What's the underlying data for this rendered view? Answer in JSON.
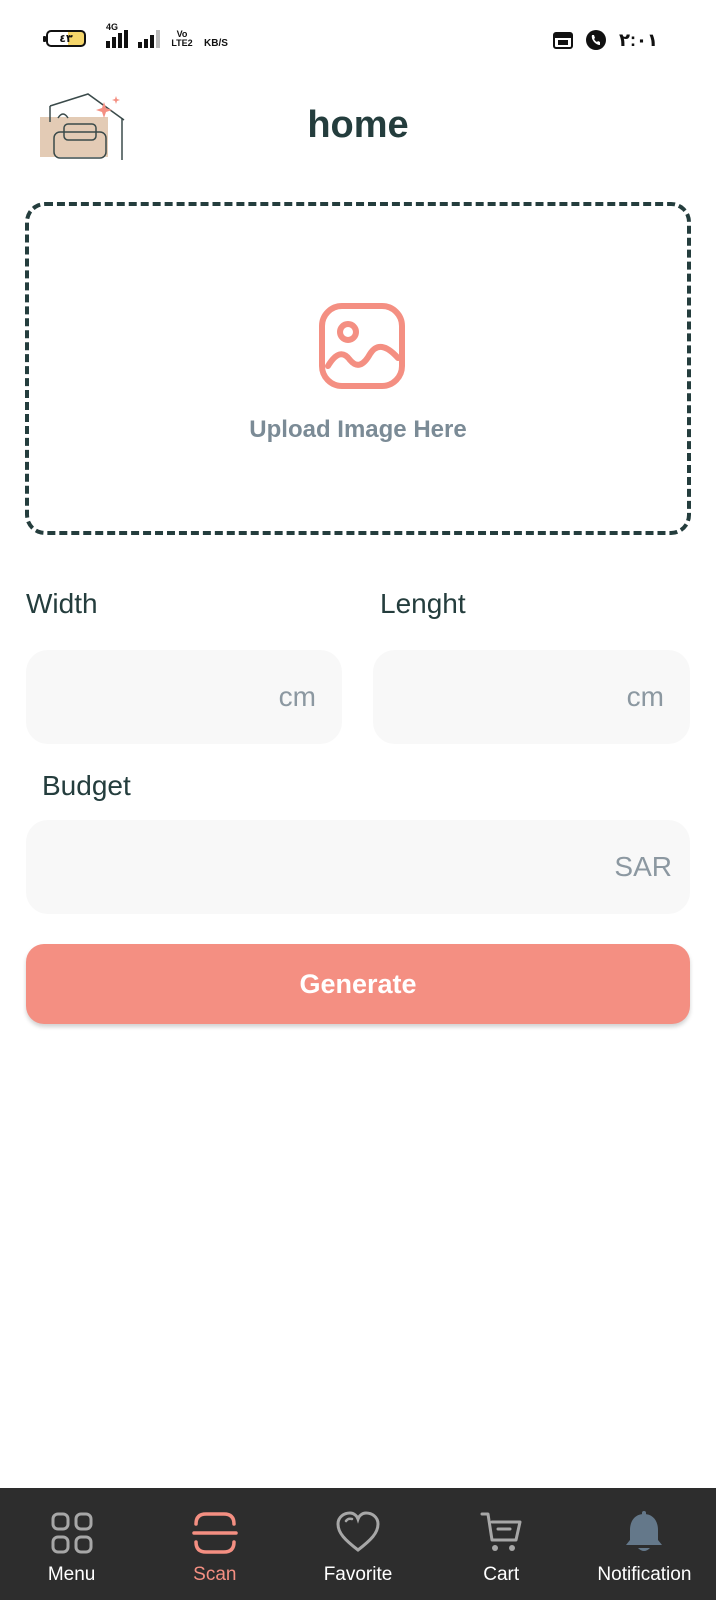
{
  "status_bar": {
    "battery": "٤٣",
    "network_type": "4G",
    "volte_label": "Vo LTE2",
    "speed_unit": "KB/S",
    "time": "٢:٠١"
  },
  "header": {
    "title": "home",
    "logo_icon": "house-sofa-logo-icon"
  },
  "upload": {
    "label": "Upload Image Here",
    "icon": "image-icon"
  },
  "form": {
    "width": {
      "label": "Width",
      "value": "",
      "unit": "cm"
    },
    "length": {
      "label": "Lenght",
      "value": "",
      "unit": "cm"
    },
    "budget": {
      "label": "Budget",
      "value": "",
      "unit": "SAR"
    }
  },
  "generate_label": "Generate",
  "colors": {
    "accent": "#f48f82",
    "dark": "#243d3d",
    "nav_bg": "#2d2d2d",
    "muted": "#8c98a1",
    "field_bg": "#f8f8f8"
  },
  "nav": {
    "items": [
      {
        "label": "Menu",
        "icon": "grid-icon",
        "active": false
      },
      {
        "label": "Scan",
        "icon": "scan-icon",
        "active": true
      },
      {
        "label": "Favorite",
        "icon": "heart-icon",
        "active": false
      },
      {
        "label": "Cart",
        "icon": "cart-icon",
        "active": false
      },
      {
        "label": "Notification",
        "icon": "bell-icon",
        "active": false
      }
    ]
  }
}
